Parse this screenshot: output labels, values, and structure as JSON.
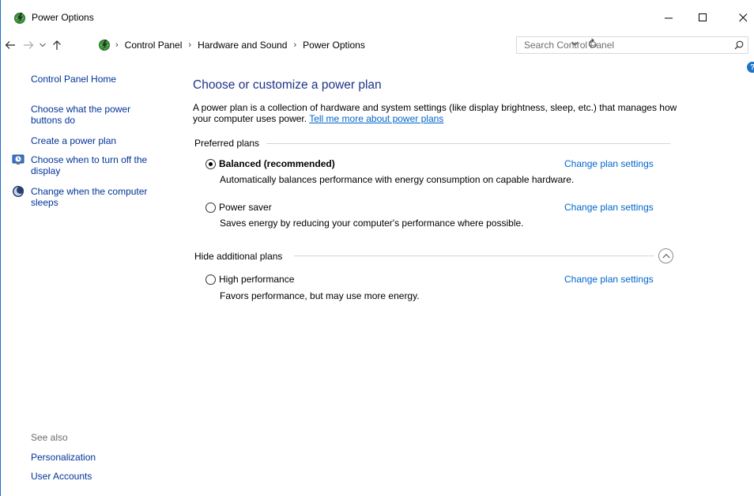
{
  "window": {
    "title": "Power Options",
    "controls": {
      "minimize": "—",
      "maximize": "☐",
      "close": "✕"
    }
  },
  "address_bar": {
    "breadcrumbs": [
      "Control Panel",
      "Hardware and Sound",
      "Power Options"
    ],
    "separator": "›"
  },
  "search": {
    "placeholder": "Search Control Panel",
    "value": ""
  },
  "help": {
    "label": "?"
  },
  "sidebar": {
    "home": "Control Panel Home",
    "links": [
      {
        "label_line1": "Choose what the power",
        "label_line2": "buttons do",
        "icon": ""
      },
      {
        "label_line1": "Create a power plan",
        "label_line2": "",
        "icon": ""
      },
      {
        "label_line1": "Choose when to turn off the",
        "label_line2": "display",
        "icon": "display-clock-icon"
      },
      {
        "label_line1": "Change when the computer",
        "label_line2": "sleeps",
        "icon": "moon-sleep-icon"
      }
    ],
    "see_also": {
      "heading": "See also",
      "links": [
        "Personalization",
        "User Accounts"
      ]
    }
  },
  "main": {
    "title": "Choose or customize a power plan",
    "description": "A power plan is a collection of hardware and system settings (like display brightness, sleep, etc.) that manages how your computer uses power.",
    "description_link": "Tell me more about power plans",
    "preferred_header": "Preferred plans",
    "hidden_header": "Hide additional plans",
    "change_label": "Change plan settings",
    "plans": [
      {
        "name": "Balanced (recommended)",
        "description": "Automatically balances performance with energy consumption on capable hardware.",
        "selected": true
      },
      {
        "name": "Power saver",
        "description": "Saves energy by reducing your computer's performance where possible.",
        "selected": false
      },
      {
        "name": "High performance",
        "description": "Favors performance, but may use more energy.",
        "selected": false
      }
    ]
  },
  "colors": {
    "link": "#0066cc",
    "sidebar_link": "#003399",
    "title": "#1e3287",
    "window_border": "#1e6ec8"
  }
}
